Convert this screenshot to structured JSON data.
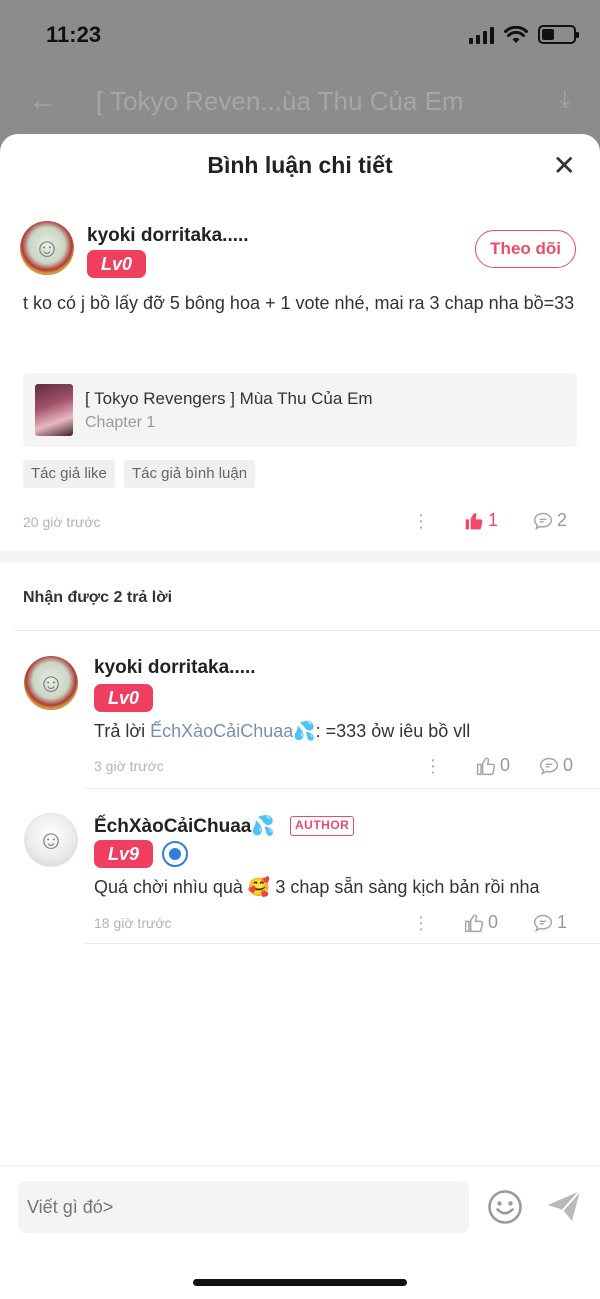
{
  "status_bar": {
    "time": "11:23"
  },
  "background_nav": {
    "title": "[ Tokyo Reven...ùa Thu Của Em"
  },
  "sheet": {
    "title": "Bình luận chi tiết"
  },
  "main_comment": {
    "username": "kyoki dorritaka.....",
    "level": "Lv0",
    "follow_label": "Theo dõi",
    "text": "t ko có j bồ lấy đỡ 5 bông hoa + 1 vote nhé, mai ra 3 chap nha bồ=33",
    "story": {
      "title": "[ Tokyo Revengers ] Mùa Thu Của Em",
      "chapter": "Chapter 1"
    },
    "tags": [
      "Tác giả like",
      "Tác giả bình luận"
    ],
    "time": "20 giờ trước",
    "likes": "1",
    "replies_count": "2"
  },
  "replies_section": {
    "title": "Nhận được 2 trả lời"
  },
  "replies": [
    {
      "username": "kyoki dorritaka.....",
      "level": "Lv0",
      "reply_prefix": "Trả lời ",
      "mention": "ẾchXàoCảiChuaa💦",
      "text": ": =333 ỏw iêu bồ vll",
      "time": "3 giờ trước",
      "likes": "0",
      "comments": "0"
    },
    {
      "username": "ẾchXàoCảiChuaa💦",
      "author_badge": "AUTHOR",
      "level": "Lv9",
      "text": "Quá chời nhìu quà 🥰 3 chap sẵn sàng kịch bản rồi nha",
      "time": "18 giờ trước",
      "likes": "0",
      "comments": "1"
    }
  ],
  "composer": {
    "placeholder": "Viết gì đó>"
  },
  "icons": {
    "back": "arrow-left-icon",
    "download": "download-icon",
    "close": "close-icon",
    "like": "thumbs-up-icon",
    "comment": "comment-bubble-icon",
    "more": "more-vertical-icon",
    "emoji": "smiley-icon",
    "send": "send-icon",
    "verified": "verified-badge-icon"
  },
  "colors": {
    "accent": "#f04a6a",
    "level_badge": "#f03e5f",
    "mention": "#7a8fb0",
    "verified": "#2f7fd6"
  }
}
